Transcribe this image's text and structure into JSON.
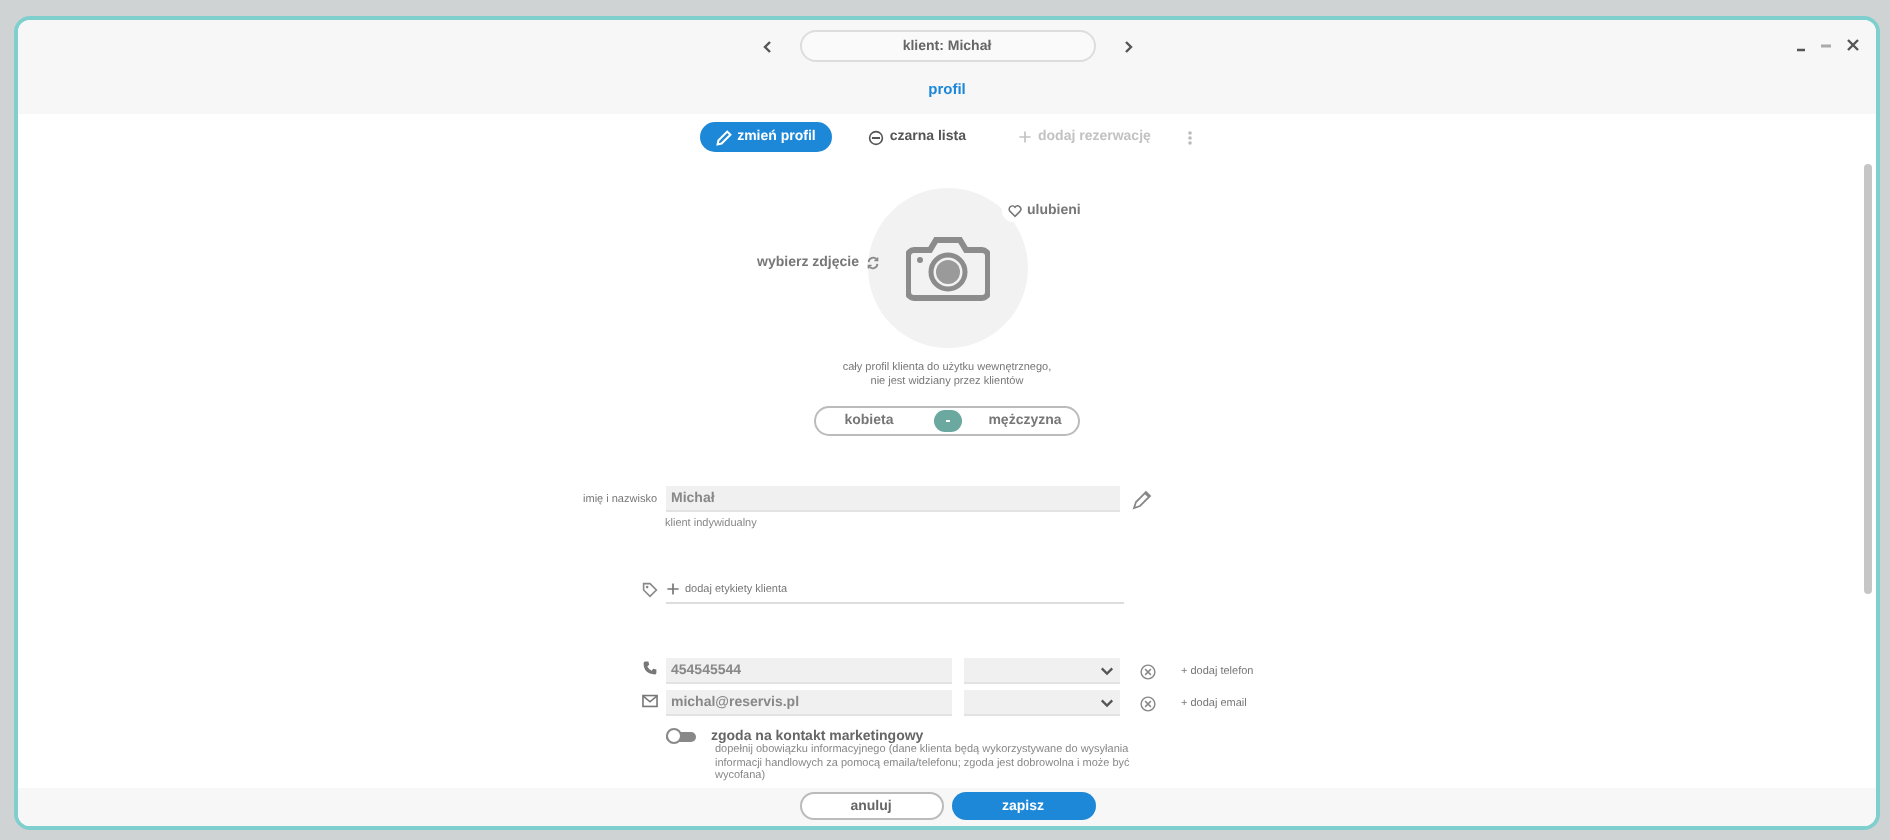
{
  "window": {
    "title": "klient: Michał",
    "section": "profil"
  },
  "actions": [
    {
      "label": "zmień profil",
      "kind": "edit",
      "disabled": false
    },
    {
      "label": "czarna lista",
      "kind": "blacklist",
      "disabled": false
    },
    {
      "label": "dodaj rezerwację",
      "kind": "add",
      "disabled": true
    }
  ],
  "photo": {
    "choose_label": "wybierz zdjęcie",
    "favorite_label": "ulubieni",
    "favorite": false
  },
  "note_lines": [
    "cały profil klienta do użytku wewnętrznego,",
    "nie jest widziany przez klientów"
  ],
  "gender": {
    "options": [
      {
        "label": "kobieta",
        "selected": false
      },
      {
        "label": "mężczyzna",
        "selected": false
      }
    ]
  },
  "name_field": {
    "label": "imię i nazwisko",
    "value": "Michał",
    "hint": "klient indywidualny"
  },
  "tags": {
    "add_label": "dodaj etykiety klienta"
  },
  "contacts": [
    {
      "kind": "phone",
      "value": "454545544",
      "add_label": "+ dodaj telefon"
    },
    {
      "kind": "email",
      "value": "michal@reservis.pl",
      "add_label": "+ dodaj email"
    }
  ],
  "marketing": {
    "label": "zgoda na kontakt marketingowy",
    "on": false,
    "description": "dopełnij obowiązku informacyjnego (dane klienta będą wykorzystywane do wysyłania informacji handlowych za pomocą emaila/telefonu; zgoda jest dobrowolna i może być wycofana)"
  },
  "buttons": [
    {
      "label": "anuluj",
      "kind": "secondary"
    },
    {
      "label": "zapisz",
      "kind": "primary"
    }
  ]
}
